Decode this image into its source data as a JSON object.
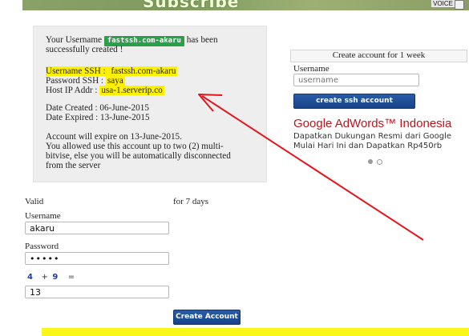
{
  "banner": {
    "title": "Subscribe",
    "voice_label": "VOICE"
  },
  "result": {
    "username_prefix": "Your Username",
    "username_badge": "fastssh.com-akaru",
    "username_suffix": "has been",
    "created_line": "successfully created !",
    "ssh_label": "Username SSH : ",
    "ssh_value": "fastssh.com-akaru",
    "password_label": "Password SSH : ",
    "password_value": "saya",
    "host_label": "Host IP Addr : ",
    "host_value": "usa-1.serverip.co",
    "date_created": "Date Created : 06-June-2015",
    "date_expired": "Date Expired : 13-June-2015",
    "expire_line": "Account will expire on 13-June-2015.",
    "limit_line1": "You allowed use this account up to two (2) multi-",
    "limit_line2": "bitvise, else you will be automatically disconnected",
    "limit_line3": "from the server"
  },
  "form": {
    "valid_label": "Valid",
    "valid_days": "for 7 days",
    "username_label": "Username",
    "username_value": "akaru",
    "password_label": "Password",
    "password_value": "•••••",
    "captcha_a": "4",
    "captcha_op": "+",
    "captcha_b": "9",
    "captcha_eq": "=",
    "captcha_value": "13",
    "create_button": "Create Account"
  },
  "sidebar": {
    "header": "Create account for 1 week",
    "username_label": "Username",
    "username_placeholder": "username",
    "ssh_button": "create ssh account",
    "ad_title": "Google AdWords™ Indonesia",
    "ad_text": "Dapatkan Dukungan Resmi dari Google Mulai Hari Ini dan Dapatkan Rp450rb"
  },
  "colors": {
    "highlight": "#fff200",
    "badge_green": "#2aa04b",
    "button_blue": "#1c4b96",
    "ad_red": "#c0141d",
    "arrow_red": "#e8141b"
  },
  "icons": {
    "arrow": "red-arrow-annotation",
    "carousel": "carousel-dots"
  }
}
